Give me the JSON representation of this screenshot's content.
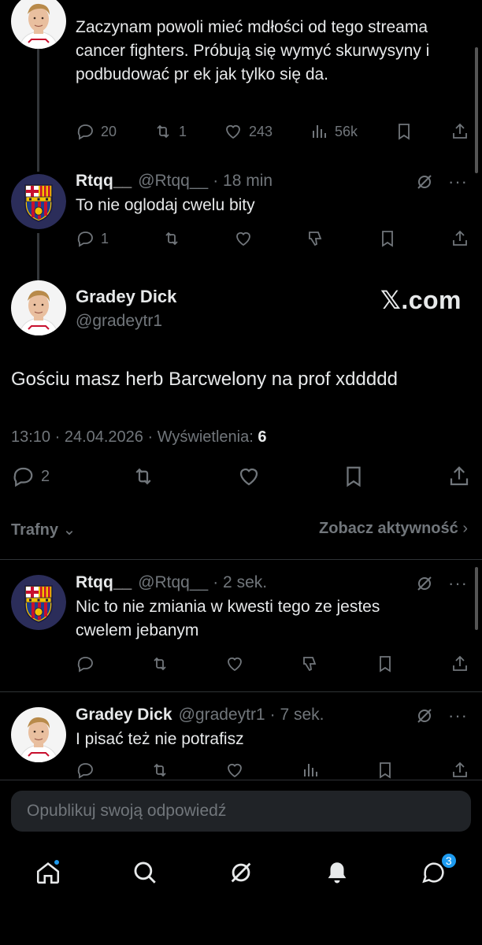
{
  "thread": {
    "top_tweet": {
      "text": "Zaczynam powoli mieć mdłości od tego streama cancer fighters. Próbują się wymyć skurwysyny i podbudować pr ek jak tylko się da.",
      "replies": "20",
      "retweets": "1",
      "likes": "243",
      "views": "56k"
    },
    "reply1": {
      "name": "Rtqq__",
      "handle": "@Rtqq__",
      "time": "· 18 min",
      "text": "To nie oglodaj cwelu bity",
      "replies": "1"
    }
  },
  "main": {
    "name": "Gradey Dick",
    "handle": "@gradeytr1",
    "watermark": "𝕏.com",
    "text": "Gościu masz herb Barcwelony na prof xddddd",
    "meta": "13:10 · 24.04.2026 · Wyświetlenia:",
    "views": "6",
    "replies": "2"
  },
  "sort": {
    "left": "Trafny",
    "right": "Zobacz aktywność"
  },
  "comments": [
    {
      "name": "Rtqq__",
      "handle": "@Rtqq__",
      "time": "· 2 sek.",
      "text": "Nic to nie zmiania w kwesti tego ze jestes cwelem jebanym"
    },
    {
      "name": "Gradey Dick",
      "handle": "@gradeytr1",
      "time": "· 7 sek.",
      "text": "I pisać też nie potrafisz"
    }
  ],
  "reply_box": {
    "placeholder": "Opublikuj swoją odpowiedź"
  },
  "nav": {
    "messages_badge": "3"
  },
  "colors": {
    "background": "#000000",
    "text": "#e7e9ea",
    "muted": "#71767b",
    "accent": "#1d9bf0",
    "divider": "#2f3336"
  }
}
